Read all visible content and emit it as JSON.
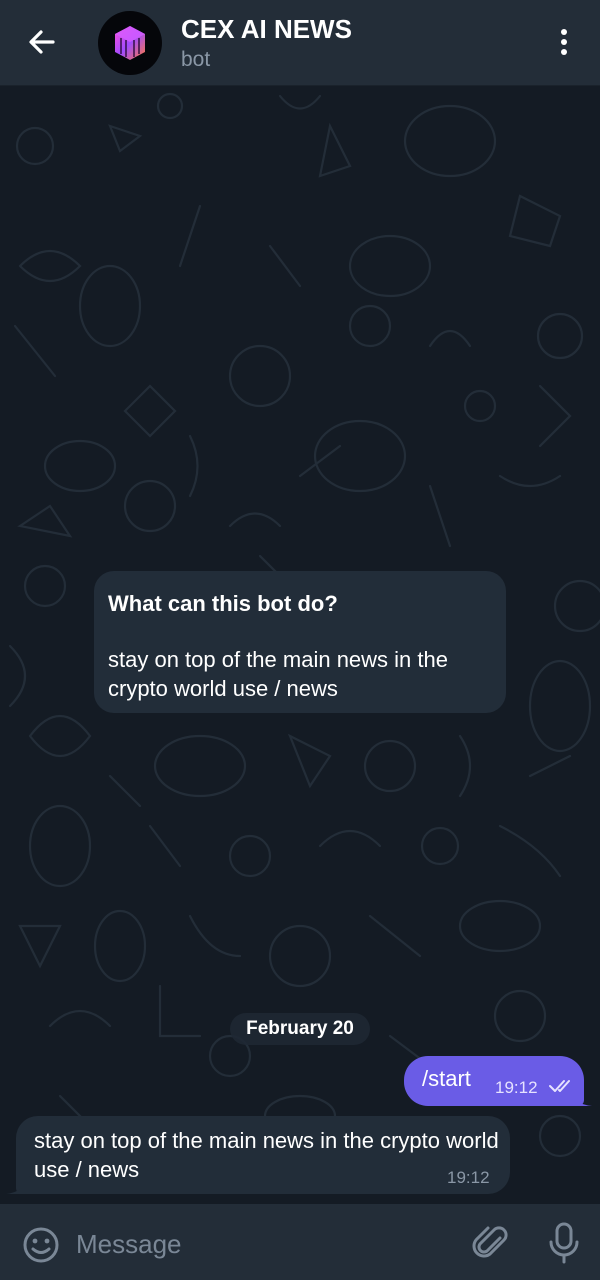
{
  "header": {
    "title": "CEX AI NEWS",
    "subtitle": "bot",
    "back_icon": "arrow-left-icon",
    "menu_icon": "vertical-dots-icon",
    "avatar_icon": "cube-logo-icon"
  },
  "bot_info": {
    "title": "What can this bot do?",
    "body": "stay on top of the main news in the crypto world use / news"
  },
  "date_separator": "February 20",
  "messages": [
    {
      "direction": "out",
      "text": "/start",
      "time": "19:12",
      "status": "read"
    },
    {
      "direction": "in",
      "text": "stay on top of the main news in the crypto world use / news",
      "time": "19:12"
    }
  ],
  "composer": {
    "placeholder": "Message",
    "emoji_icon": "smile-icon",
    "attach_icon": "paperclip-icon",
    "mic_icon": "microphone-icon"
  },
  "colors": {
    "header_bg": "#232d38",
    "chat_bg": "#141b24",
    "incoming_bubble": "#222d39",
    "outgoing_bubble": "#6a5ce6",
    "secondary_text": "#8a97a6"
  }
}
